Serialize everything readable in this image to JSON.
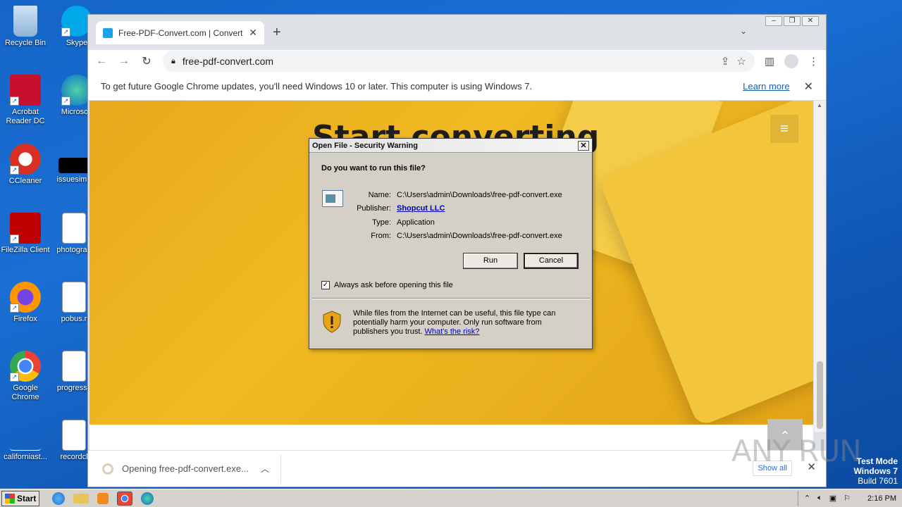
{
  "desktop": {
    "icons": [
      {
        "label": "Recycle Bin",
        "icon": "recycle-bin-icon"
      },
      {
        "label": "Skype",
        "icon": "skype-icon"
      },
      {
        "label": "Acrobat Reader DC",
        "icon": "acrobat-icon"
      },
      {
        "label": "Microsoft",
        "icon": "edge-icon"
      },
      {
        "label": "CCleaner",
        "icon": "ccleaner-icon"
      },
      {
        "label": "issuesimp",
        "icon": "blank-app-icon"
      },
      {
        "label": "FileZilla Client",
        "icon": "filezilla-icon"
      },
      {
        "label": "photograp",
        "icon": "word-doc-icon"
      },
      {
        "label": "Firefox",
        "icon": "firefox-icon"
      },
      {
        "label": "pobus.r",
        "icon": "word-doc-icon"
      },
      {
        "label": "Google Chrome",
        "icon": "chrome-icon"
      },
      {
        "label": "progressc",
        "icon": "word-doc-icon"
      },
      {
        "label": "californiast...",
        "icon": "blank-file-icon"
      },
      {
        "label": "recordcl",
        "icon": "word-doc-icon"
      }
    ]
  },
  "browser": {
    "tab_title": "Free-PDF-Convert.com | Convert hu",
    "url": "free-pdf-convert.com",
    "infobar_message": "To get future Google Chrome updates, you'll need Windows 10 or later. This computer is using Windows 7.",
    "infobar_link": "Learn more",
    "page_headline": "Start converting",
    "download_text": "Opening free-pdf-convert.exe...",
    "show_all": "Show all"
  },
  "dialog": {
    "title": "Open File - Security Warning",
    "question": "Do you want to run this file?",
    "labels": {
      "name": "Name:",
      "publisher": "Publisher:",
      "type": "Type:",
      "from": "From:"
    },
    "name": "C:\\Users\\admin\\Downloads\\free-pdf-convert.exe",
    "publisher": "Shopcut LLC",
    "type": "Application",
    "from": "C:\\Users\\admin\\Downloads\\free-pdf-convert.exe",
    "run_button": "Run",
    "cancel_button": "Cancel",
    "checkbox_label": "Always ask before opening this file",
    "checkbox_checked": true,
    "warning_text": "While files from the Internet can be useful, this file type can potentially harm your computer. Only run software from publishers you trust.",
    "warning_link": "What's the risk?"
  },
  "watermark": "ANY RUN",
  "test_mode": {
    "line1": "Test Mode",
    "line2": "Windows 7",
    "line3": "Build 7601"
  },
  "taskbar": {
    "start_label": "Start",
    "clock": "2:16 PM"
  }
}
